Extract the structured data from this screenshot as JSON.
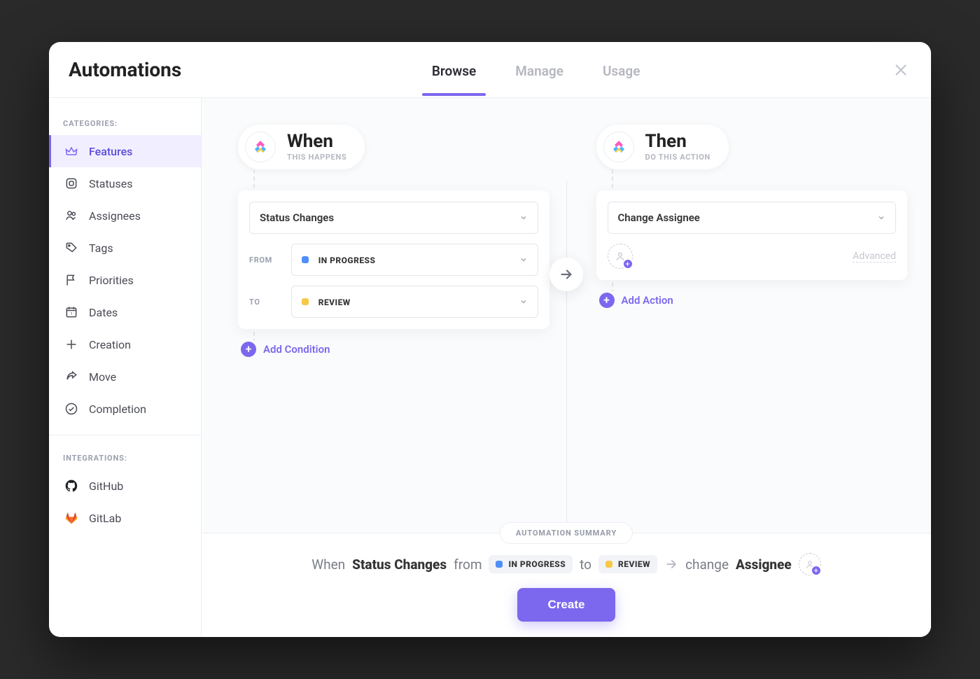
{
  "header": {
    "title": "Automations",
    "tabs": [
      {
        "label": "Browse",
        "active": true
      },
      {
        "label": "Manage",
        "active": false
      },
      {
        "label": "Usage",
        "active": false
      }
    ]
  },
  "sidebar": {
    "categories_label": "CATEGORIES:",
    "categories": [
      {
        "name": "Features",
        "icon": "crown-icon",
        "active": true
      },
      {
        "name": "Statuses",
        "icon": "square-icon"
      },
      {
        "name": "Assignees",
        "icon": "users-icon"
      },
      {
        "name": "Tags",
        "icon": "tag-icon"
      },
      {
        "name": "Priorities",
        "icon": "flag-icon"
      },
      {
        "name": "Dates",
        "icon": "calendar-icon"
      },
      {
        "name": "Creation",
        "icon": "plus-icon"
      },
      {
        "name": "Move",
        "icon": "share-icon"
      },
      {
        "name": "Completion",
        "icon": "check-circle-icon"
      }
    ],
    "integrations_label": "INTEGRATIONS:",
    "integrations": [
      {
        "name": "GitHub",
        "icon": "github-icon"
      },
      {
        "name": "GitLab",
        "icon": "gitlab-icon"
      }
    ]
  },
  "when": {
    "title": "When",
    "subtitle": "THIS HAPPENS",
    "trigger": "Status Changes",
    "from_label": "FROM",
    "from_status": {
      "name": "IN PROGRESS",
      "color": "#4f8ff7"
    },
    "to_label": "TO",
    "to_status": {
      "name": "REVIEW",
      "color": "#f7c948"
    },
    "add_condition": "Add Condition"
  },
  "then": {
    "title": "Then",
    "subtitle": "DO THIS ACTION",
    "action": "Change Assignee",
    "advanced": "Advanced",
    "add_action": "Add Action"
  },
  "summary": {
    "pill": "AUTOMATION SUMMARY",
    "when_word": "When",
    "trigger_bold": "Status Changes",
    "from_word": "from",
    "from_status": {
      "name": "IN PROGRESS",
      "color": "#4f8ff7"
    },
    "to_word": "to",
    "to_status": {
      "name": "REVIEW",
      "color": "#f7c948"
    },
    "change_word": "change",
    "assignee_bold": "Assignee",
    "create_label": "Create"
  },
  "colors": {
    "accent": "#7b68ee"
  }
}
